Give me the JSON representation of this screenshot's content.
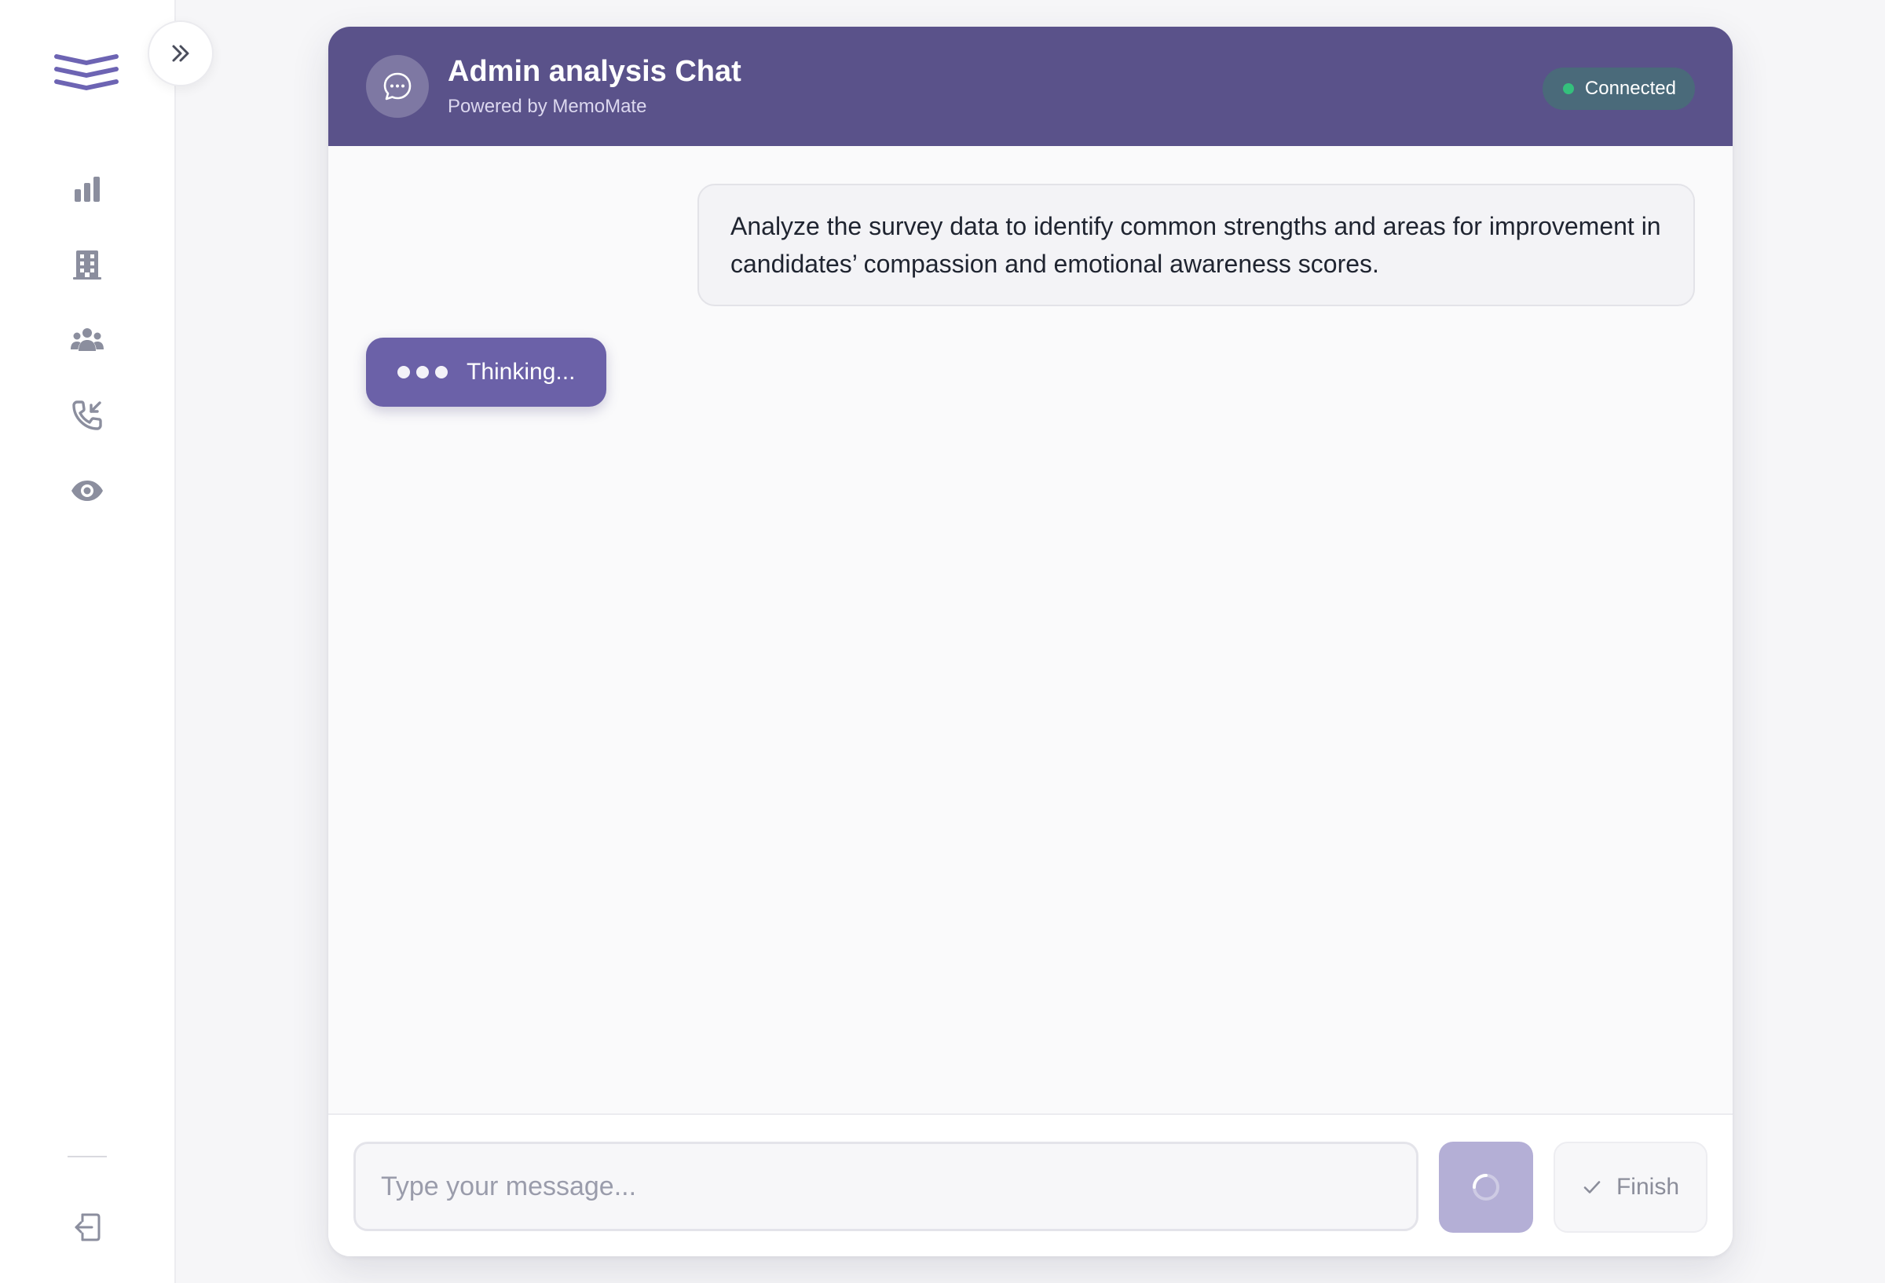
{
  "app": {
    "accent_color": "#5a528a",
    "icon_color": "#8b8e9e"
  },
  "sidebar": {
    "logo_icon": "layers-logo-icon",
    "items": [
      {
        "name": "analytics",
        "icon": "bar-chart-icon"
      },
      {
        "name": "organizations",
        "icon": "building-icon"
      },
      {
        "name": "users",
        "icon": "users-group-icon"
      },
      {
        "name": "calls",
        "icon": "phone-incoming-icon"
      },
      {
        "name": "monitor",
        "icon": "eye-icon"
      }
    ],
    "logout_icon": "logout-icon",
    "toggle_icon": "chevrons-right-icon"
  },
  "chat": {
    "title": "Admin analysis Chat",
    "subtitle": "Powered by MemoMate",
    "status": "Connected",
    "status_color": "#34c07c",
    "messages": [
      {
        "role": "user",
        "text": "Analyze the survey data to identify common strengths and areas for improvement in candidates’ compassion and emotional awareness scores."
      }
    ],
    "thinking_label": "Thinking...",
    "input": {
      "value": "",
      "placeholder": "Type your message..."
    },
    "send_state": "loading",
    "finish_label": "Finish"
  }
}
